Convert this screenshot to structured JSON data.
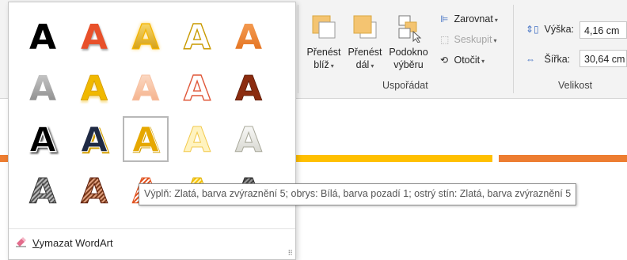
{
  "ribbon": {
    "arrange": {
      "bring_forward": {
        "line1": "Přenést",
        "line2": "blíž"
      },
      "send_backward": {
        "line1": "Přenést",
        "line2": "dál"
      },
      "selection_pane": {
        "line1": "Podokno",
        "line2": "výběru"
      },
      "align": "Zarovnat",
      "group": "Seskupit",
      "rotate": "Otočit",
      "group_label": "Uspořádat"
    },
    "size": {
      "height_label": "Výška:",
      "height_value": "4,16 cm",
      "width_label": "Šířka:",
      "width_value": "30,64 cm",
      "group_label": "Velikost"
    }
  },
  "gallery": {
    "styles": [
      [
        {
          "name": "plain-black"
        },
        {
          "name": "orange-shadow"
        },
        {
          "name": "gold-outline"
        },
        {
          "name": "gold-outline-light"
        },
        {
          "name": "orange-gradient"
        }
      ],
      [
        {
          "name": "gray-gradient"
        },
        {
          "name": "gold-reflection"
        },
        {
          "name": "peach-outline"
        },
        {
          "name": "coral-outline"
        },
        {
          "name": "brown-bevel"
        }
      ],
      [
        {
          "name": "black-white-glow"
        },
        {
          "name": "dark-blue-gold"
        },
        {
          "name": "gold-selected"
        },
        {
          "name": "pale-gold"
        },
        {
          "name": "white-silver"
        }
      ],
      [
        {
          "name": "gray-pattern"
        },
        {
          "name": "brown-pattern"
        },
        {
          "name": "orange-pattern"
        },
        {
          "name": "gold-pattern"
        },
        {
          "name": "dark-pattern"
        }
      ]
    ],
    "glyph": "A",
    "selected_index": [
      2,
      2
    ],
    "clear_prefix": "V",
    "clear_rest": "ymazat WordArt",
    "resize_glyph": "⠿"
  },
  "tooltip": "Výplň: Zlatá, barva zvýraznění 5; obrys: Bílá, barva pozadí 1; ostrý stín: Zlatá, barva zvýraznění 5",
  "colors": {
    "accent_orange": "#ed7d31",
    "accent_gold": "#ffc000",
    "selection_border": "#b8b8b8"
  }
}
